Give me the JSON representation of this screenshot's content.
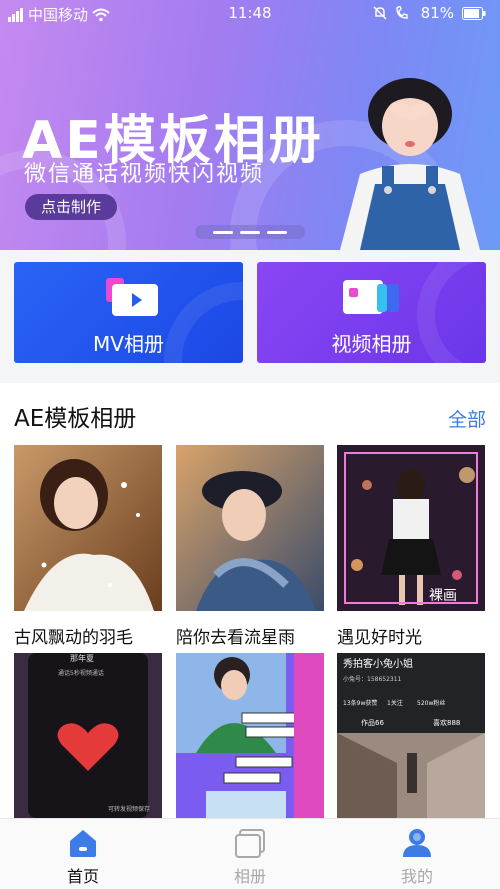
{
  "status_bar": {
    "carrier": "中国移动",
    "time": "11:48",
    "battery": "81%"
  },
  "banner": {
    "title": "AE模板相册",
    "subtitle": "微信通话视频快闪视频",
    "button": "点击制作",
    "page_count": 3
  },
  "categories": [
    {
      "label": "MV相册",
      "icon": "mv-album-icon",
      "color": "#1f55ee"
    },
    {
      "label": "视频相册",
      "icon": "video-album-icon",
      "color": "#7a3ff0"
    }
  ],
  "section": {
    "title": "AE模板相册",
    "more": "全部",
    "items": [
      {
        "caption": "古风飘动的羽毛"
      },
      {
        "caption": "陪你去看流星雨"
      },
      {
        "caption": "遇见好时光"
      }
    ],
    "preview_texts": {
      "card4_name": "那年夏",
      "card4_line": "通话5秒视频通话",
      "card4_end": "可转发视频保存",
      "card6_name": "秀拍客小兔小姐",
      "card6_id": "小兔号：158652311",
      "card6_stats": [
        "13条9w获赞",
        "1关注",
        "520w粉丝"
      ],
      "card6_tabs": [
        "作品66",
        "喜欢888"
      ],
      "card2_overlay": "裸画"
    }
  },
  "tab_bar": {
    "items": [
      {
        "label": "首页",
        "icon": "home-icon",
        "active": true
      },
      {
        "label": "相册",
        "icon": "album-icon",
        "active": false
      },
      {
        "label": "我的",
        "icon": "profile-icon",
        "active": false
      }
    ],
    "active_color": "#3d7be6",
    "inactive_color": "#a8a8a8"
  }
}
